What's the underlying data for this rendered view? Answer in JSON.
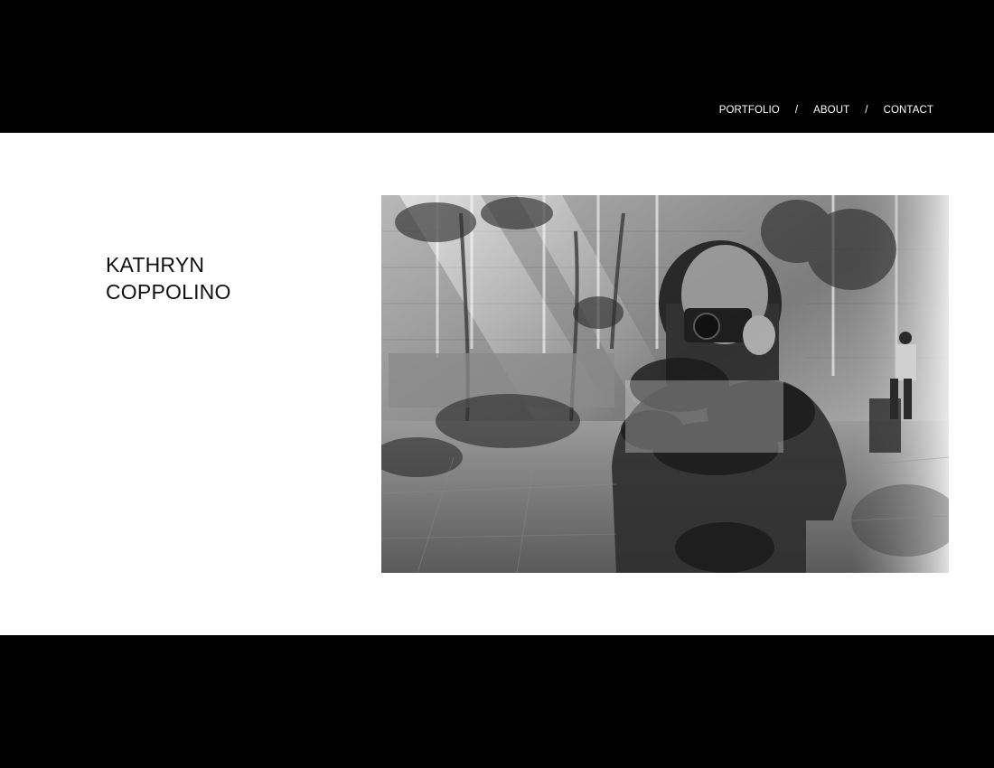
{
  "nav": {
    "items": [
      "PORTFOLIO",
      "ABOUT",
      "CONTACT"
    ],
    "separator": "/"
  },
  "artist": {
    "first_name": "KATHRYN",
    "last_name": "COPPOLINO"
  },
  "hero_image": {
    "subject": "photographer-reflection-atrium"
  },
  "colors": {
    "background": "#000000",
    "panel": "#ffffff",
    "text_dark": "#111111",
    "nav_text": "#ffffff"
  }
}
